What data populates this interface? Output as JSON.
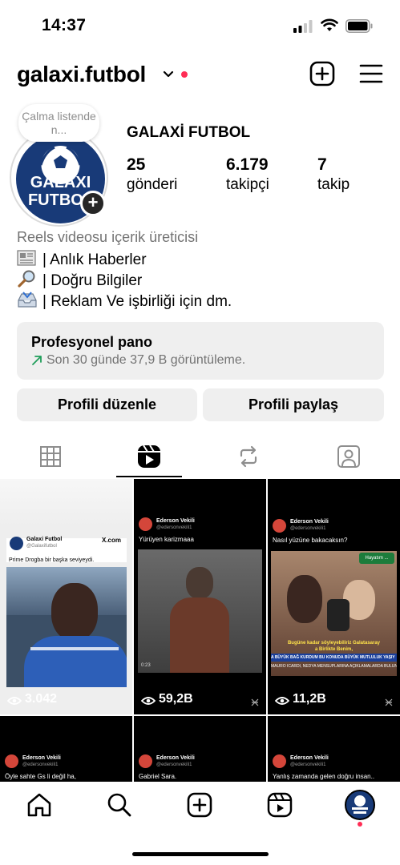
{
  "status_bar": {
    "time": "14:37"
  },
  "header": {
    "username": "galaxi.futbol"
  },
  "profile": {
    "note": "Çalma listende n...",
    "avatar_text_line1": "GALAXI",
    "avatar_text_line2": "FUTBOL",
    "full_name": "GALAXİ FUTBOL",
    "stats": [
      {
        "value": "25",
        "label": "gönderi"
      },
      {
        "value": "6.179",
        "label": "takipçi"
      },
      {
        "value": "7",
        "label": "takip"
      }
    ],
    "category": "Reels videosu içerik üreticisi",
    "bio_lines": [
      "| Anlık Haberler",
      "| Doğru Bilgiler",
      "| Reklam Ve işbirliği için dm."
    ]
  },
  "dashboard": {
    "title": "Profesyonel pano",
    "subtitle": "Son 30 günde 37,9 B görüntüleme."
  },
  "buttons": {
    "edit": "Profili düzenle",
    "share": "Profili paylaş"
  },
  "grid": [
    {
      "author": "Galaxi Futbol",
      "handle": "@Galaxifutbol",
      "source": "X.com",
      "caption": "Prime Drogba bir başka seviyeydi.",
      "views": "3.042"
    },
    {
      "author": "Ederson Vekili",
      "handle": "@edersonvekili1",
      "caption": "Yürüyen karizmaaa",
      "duration": "0:23",
      "views": "59,2B"
    },
    {
      "author": "Ederson Vekili",
      "handle": "@edersonvekili1",
      "caption": "Nasıl yüzüne bakacaksın?",
      "overlay_top": "Hayatım ...",
      "overlay_line1": "Bugüne kadar söyleyebiliriz Galatasaray",
      "overlay_line2": "a Birlikte Benim,",
      "overlay_line3": "A BÜYÜK BAĞ KURDUM BU KONUDA BÜYÜK MUTLULUK YAŞIY",
      "overlay_line4": "MAURO ICARDI, NEDYA MENSUPLARINA AÇIKLAMALARDA BULUN",
      "views": "11,2B"
    },
    {
      "author": "Ederson Vekili",
      "handle": "@edersonvekili1",
      "caption": "Öyle sahte Gs li değil ha,"
    },
    {
      "author": "Ederson Vekili",
      "handle": "@edersonvekili1",
      "caption": "Gabriel Sara."
    },
    {
      "author": "Ederson Vekili",
      "handle": "@edersonvekili1",
      "caption": "Yanlış zamanda gelen doğru insan.."
    }
  ],
  "icons": {
    "tabs": [
      "grid-icon",
      "reels-icon",
      "repost-icon",
      "tagged-icon"
    ],
    "nav": [
      "home-icon",
      "search-icon",
      "create-icon",
      "reels-icon",
      "profile-avatar"
    ]
  },
  "colors": {
    "accent_red": "#ff2d55",
    "avatar_bg": "#183a78"
  }
}
